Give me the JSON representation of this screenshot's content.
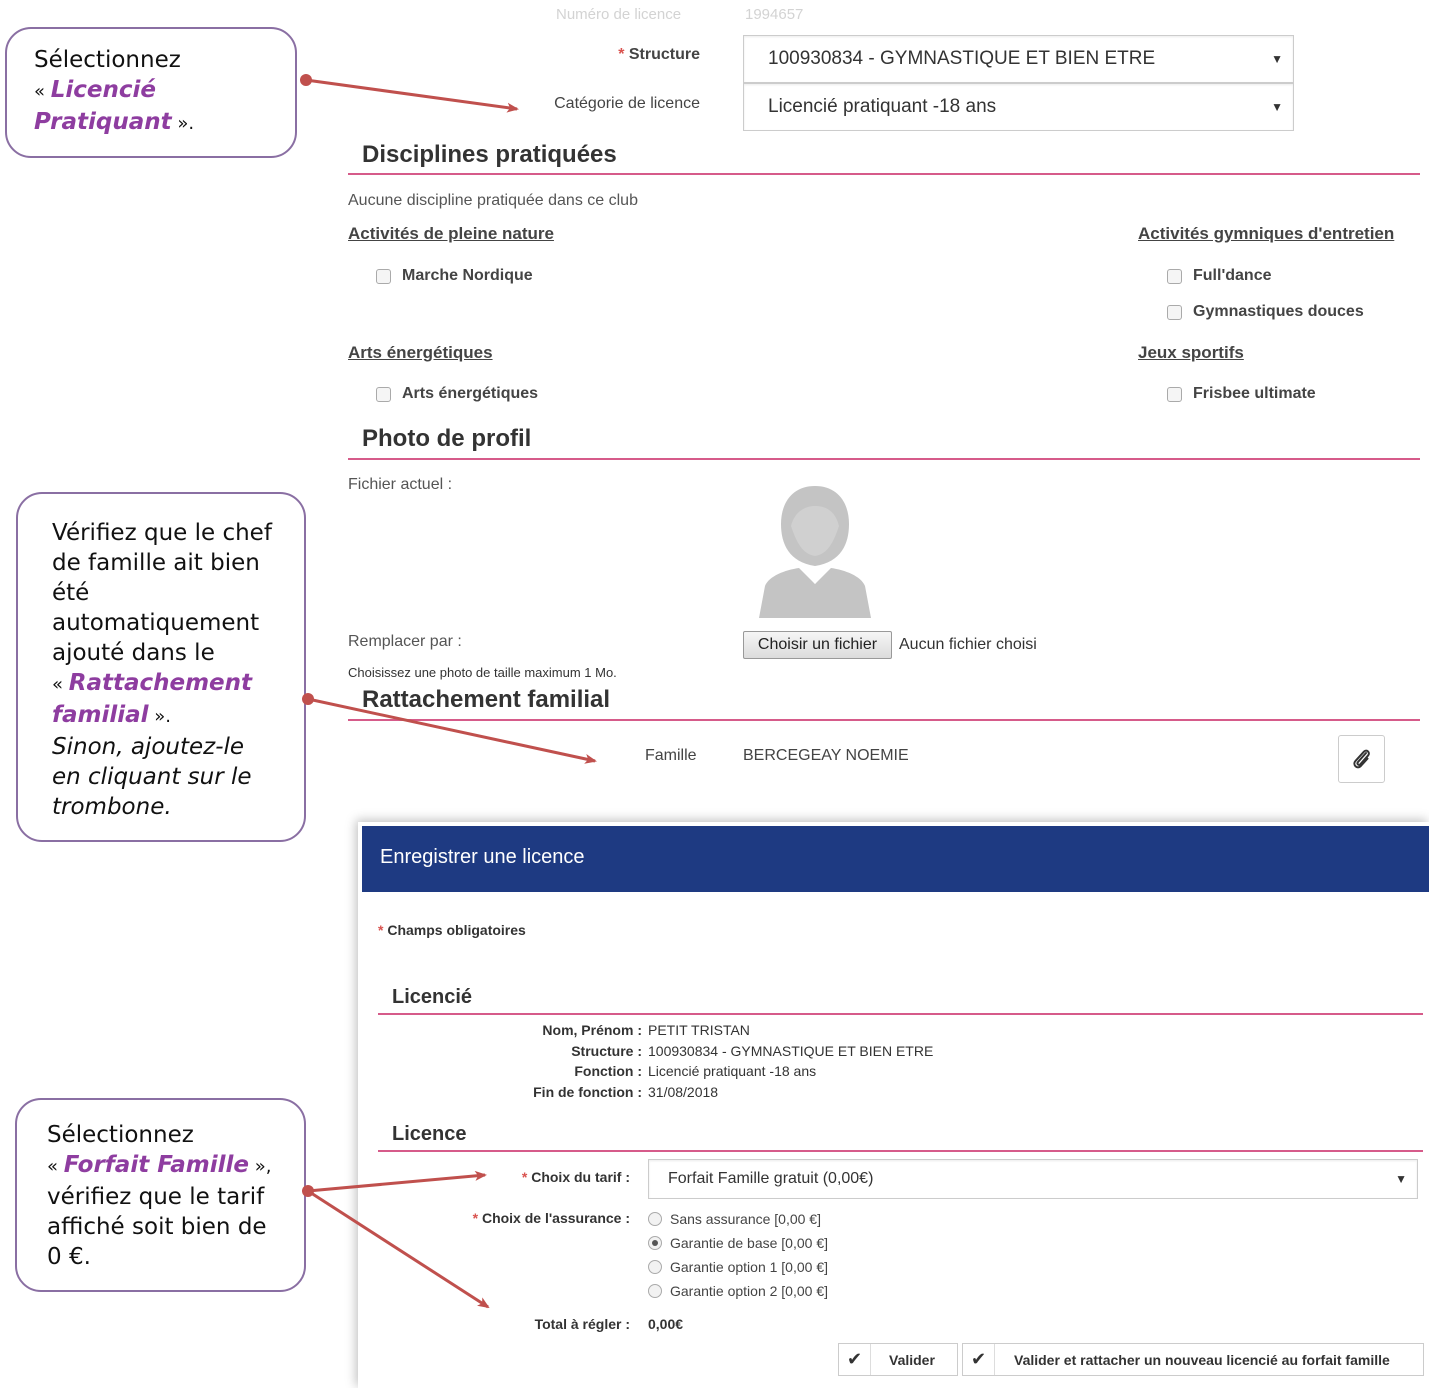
{
  "callouts": {
    "c1": {
      "l1": "Sélectionnez",
      "q_open": "« ",
      "hl": "Licencié Pratiquant",
      "q_close": " »."
    },
    "c2": {
      "l1": "Vérifiez que le chef de famille ait bien été automatiquement ajouté dans le",
      "q_open": "« ",
      "hl": "Rattachement familial",
      "q_close": " ».",
      "italic": "Sinon, ajoutez-le en cliquant sur le trombone."
    },
    "c3": {
      "l1": "Sélectionnez",
      "q_open": "« ",
      "hl": "Forfait Famille",
      "q_close": " »,",
      "rest": "vérifiez que le tarif affiché soit bien de 0 €."
    }
  },
  "form": {
    "licence_number_label": "Numéro de licence",
    "licence_number_value": "1994657",
    "structure_label": "Structure",
    "structure_value": "100930834 - GYMNASTIQUE ET BIEN ETRE",
    "category_label": "Catégorie de licence",
    "category_value": "Licencié pratiquant -18 ans"
  },
  "disciplines": {
    "title": "Disciplines pratiquées",
    "note": "Aucune discipline pratiquée dans ce club",
    "groups": [
      {
        "title": "Activités de pleine nature",
        "items": [
          "Marche Nordique"
        ]
      },
      {
        "title": "Activités gymniques d'entretien",
        "items": [
          "Full'dance",
          "Gymnastiques douces"
        ]
      },
      {
        "title": "Arts énergétiques",
        "items": [
          "Arts énergétiques"
        ]
      },
      {
        "title": "Jeux sportifs",
        "items": [
          "Frisbee ultimate"
        ]
      }
    ]
  },
  "photo": {
    "title": "Photo de profil",
    "current_label": "Fichier actuel :",
    "replace_label": "Remplacer par :",
    "choose_button": "Choisir un fichier",
    "no_file": "Aucun fichier choisi",
    "hint": "Choisissez une photo de taille maximum 1 Mo."
  },
  "family": {
    "title": "Rattachement familial",
    "label": "Famille",
    "value": "BERCEGEAY NOEMIE"
  },
  "modal": {
    "title": "Enregistrer une licence",
    "required_note": "Champs obligatoires",
    "licencie": {
      "title": "Licencié",
      "rows": [
        {
          "label": "Nom, Prénom :",
          "value": "PETIT TRISTAN"
        },
        {
          "label": "Structure :",
          "value": "100930834 - GYMNASTIQUE ET BIEN ETRE"
        },
        {
          "label": "Fonction :",
          "value": "Licencié pratiquant -18 ans"
        },
        {
          "label": "Fin de fonction :",
          "value": "31/08/2018"
        }
      ]
    },
    "licence": {
      "title": "Licence",
      "tarif_label": "Choix du tarif :",
      "tarif_value": "Forfait Famille gratuit (0,00€)",
      "assurance_label": "Choix de l'assurance :",
      "assurance_options": [
        "Sans assurance [0,00 €]",
        "Garantie de base [0,00 €]",
        "Garantie option 1 [0,00 €]",
        "Garantie option 2 [0,00 €]"
      ],
      "assurance_selected": 1,
      "total_label": "Total à régler :",
      "total_value": "0,00€"
    },
    "buttons": {
      "validate": "Valider",
      "validate_attach": "Valider et rattacher un nouveau licencié au forfait famille"
    }
  },
  "colors": {
    "accent_rule": "#d65b8a",
    "modal_header": "#1e3a82",
    "callout_border": "#8a6fa3",
    "highlight": "#8e3da0",
    "arrow": "#c0504d"
  }
}
